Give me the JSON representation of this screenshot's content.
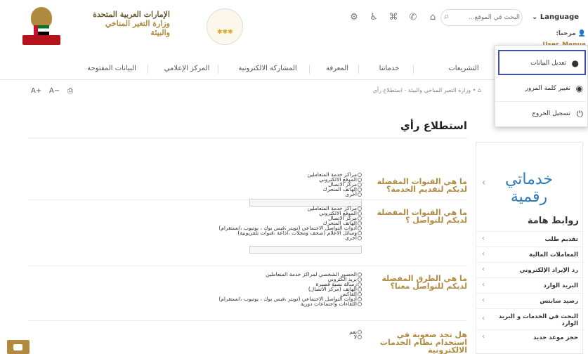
{
  "header": {
    "ministry_line1": "الإمارات العربية المتحدة",
    "ministry_line2": "وزارة التغير المناخي",
    "ministry_line3": "والبيئة",
    "language_label": "Language",
    "search_placeholder": "البحث في الموقع...",
    "user_greeting": "مرحبا:",
    "user_name": "User_Manua"
  },
  "nav": {
    "items": [
      "التشريعات",
      "خدماتنا",
      "المعرفة",
      "المشاركة الالكترونية",
      "المركز الإعلامي",
      "البيانات المفتوحة"
    ]
  },
  "toolbar": {
    "font_increase": "A+",
    "font_decrease": "A−"
  },
  "breadcrumb": {
    "home": "⌂",
    "parent": "وزارة التغير المناخي والبيئة",
    "current": "استطلاع رأي"
  },
  "poll": {
    "title": "استطلاع رأي",
    "questions": [
      {
        "text": "ما هي القنوات المفضلة لديكم لتقديم الخدمة؟",
        "options": [
          "مراكز خدمة المتعاملين",
          "الموقع الالكتروني",
          "مركز الاتصال",
          "الهاتف المتحرك",
          "أخرى"
        ]
      },
      {
        "text": "ما هي القنوات المفضلة لديكم للتواصل ؟",
        "options": [
          "مراكز خدمة المتعاملين",
          "الموقع الالكتروني",
          "مركز الاتصال",
          "الهاتف المتحرك",
          "أدوات التواصل الاجتماعي (تويتر ،فيس بوك ، يوتيوب ،انستقرام)",
          "وسائل الاعلام (صحف ومجلات ،اذاعة ،قنوات تلفزيونية)",
          "أخرى"
        ]
      },
      {
        "text": "ما هي الطرق المفضلة لديكم للتواصل معنا؟",
        "options": [
          "الحضور الشخصي لمراكز خدمة المتعاملين",
          "بريد الكتروني",
          "رسالة نصية قصيرة",
          "الهاتف (مركز الاتصال)",
          "الفاكس",
          "أدوات التواصل الاجتماعي (تويتر ،فيس بوك ، يوتيوب ،انستقرام)",
          "اللقاءات واجتماعات دورية"
        ]
      },
      {
        "text": "هل تجد صعوبة في استخدام نظام الخدمات الالكترونية",
        "options": [
          "نعم",
          "لا"
        ]
      }
    ]
  },
  "sidebar": {
    "digital_line1": "خدماتي",
    "digital_line2": "رقمية",
    "links_title": "روابط هامة",
    "links": [
      "تقديم طلب",
      "المعاملات المالية",
      "رد الإيراد الإلكتروني",
      "البريد الوارد",
      "رصيد سابتس",
      "البحث في الخدمات و البريد الوارد",
      "حجز موعد جديد"
    ]
  },
  "user_menu": {
    "items": [
      {
        "label": "تعديل البيانات",
        "icon": "user-icon"
      },
      {
        "label": "تغيير كلمة المرور",
        "icon": "lock-icon"
      },
      {
        "label": "تسجيل الخروج",
        "icon": "power-icon"
      }
    ]
  },
  "colors": {
    "accent_gold": "#b08a3e",
    "highlight_blue": "#3a4fc0",
    "digital_blue": "#2b7bb9"
  }
}
